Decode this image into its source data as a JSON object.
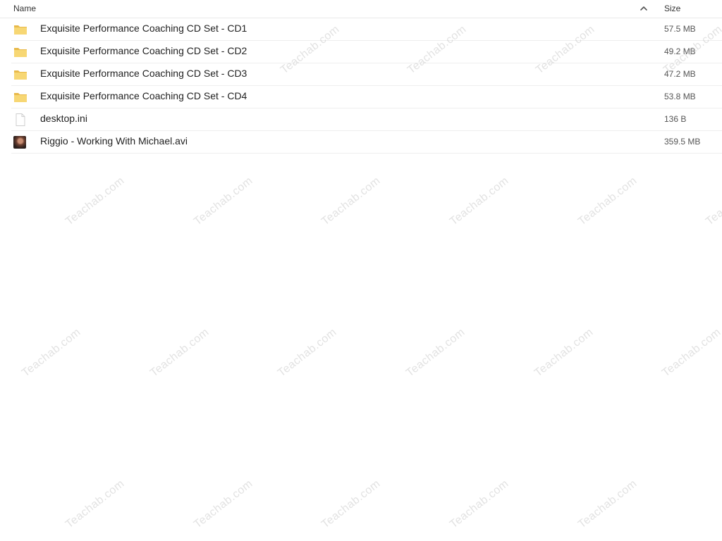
{
  "header": {
    "name_label": "Name",
    "size_label": "Size",
    "sort_icon": "chevron-up-icon"
  },
  "files": [
    {
      "name": "Exquisite Performance Coaching CD Set - CD1",
      "size": "57.5 MB",
      "icon": "folder-icon"
    },
    {
      "name": "Exquisite Performance Coaching CD Set - CD2",
      "size": "49.2 MB",
      "icon": "folder-icon"
    },
    {
      "name": "Exquisite Performance Coaching CD Set - CD3",
      "size": "47.2 MB",
      "icon": "folder-icon"
    },
    {
      "name": "Exquisite Performance Coaching CD Set - CD4",
      "size": "53.8 MB",
      "icon": "folder-icon"
    },
    {
      "name": "desktop.ini",
      "size": "136 B",
      "icon": "document-icon"
    },
    {
      "name": "Riggio - Working With Michael.avi",
      "size": "359.5 MB",
      "icon": "video-thumbnail-icon"
    }
  ],
  "watermark": "Teachab.com",
  "colors": {
    "folder": "#f7d774",
    "folder_dark": "#e8b94a",
    "divider": "#eeeeee"
  }
}
